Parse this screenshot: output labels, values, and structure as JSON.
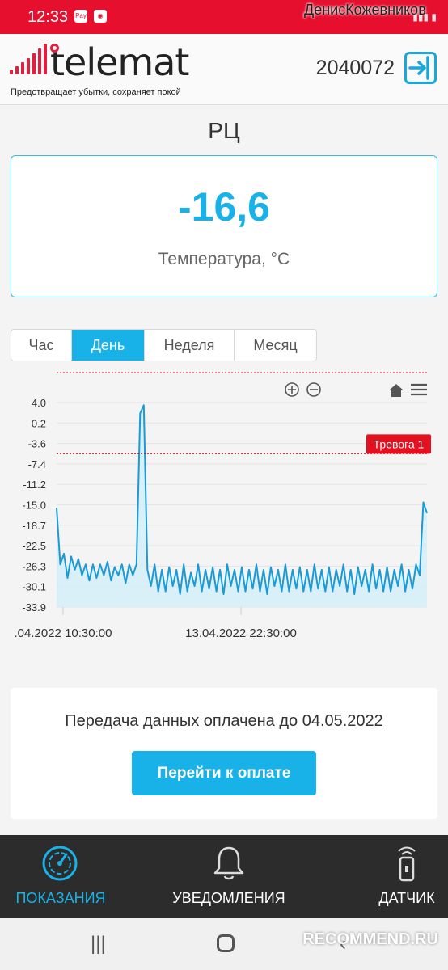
{
  "status_bar": {
    "time": "12:33",
    "username": "ДенисКожевников"
  },
  "header": {
    "brand": "telemat",
    "tagline": "Предотвращает убытки, сохраняет покой",
    "device_id": "2040072"
  },
  "title": "РЦ",
  "temperature": {
    "value": "-16,6",
    "label": "Температура, °C"
  },
  "tabs": [
    {
      "label": "Час",
      "active": false
    },
    {
      "label": "День",
      "active": true
    },
    {
      "label": "Неделя",
      "active": false
    },
    {
      "label": "Месяц",
      "active": false
    }
  ],
  "chart_data": {
    "type": "area",
    "ytick_labels": [
      "4.0",
      "0.2",
      "-3.6",
      "-7.4",
      "-11.2",
      "-15.0",
      "-18.7",
      "-22.5",
      "-26.3",
      "-30.1",
      "-33.9"
    ],
    "ylim": [
      -33.9,
      4.0
    ],
    "xtick_labels": [
      ".04.2022 10:30:00",
      "13.04.2022 22:30:00"
    ],
    "alarm_label": "Тревога 1",
    "alarm_threshold": -5.5,
    "grid": true,
    "series": [
      {
        "values": [
          -15.5,
          -26.0,
          -24.0,
          -28.5,
          -24.5,
          -27.0,
          -25.0,
          -28.0,
          -26.0,
          -29.0,
          -26.0,
          -28.5,
          -26.0,
          -28.0,
          -25.5,
          -29.0,
          -26.5,
          -28.0,
          -26.0,
          -29.5,
          -26.0,
          -28.0,
          -26.0,
          2.0,
          3.5,
          -27.0,
          -30.0,
          -26.0,
          -31.0,
          -27.0,
          -31.0,
          -26.5,
          -30.0,
          -27.0,
          -31.5,
          -26.0,
          -31.0,
          -27.5,
          -30.0,
          -26.0,
          -31.0,
          -27.0,
          -30.5,
          -26.5,
          -31.0,
          -27.0,
          -31.5,
          -26.0,
          -30.0,
          -27.0,
          -31.0,
          -26.5,
          -31.0,
          -27.0,
          -30.5,
          -26.0,
          -31.0,
          -27.0,
          -31.5,
          -26.5,
          -30.0,
          -27.0,
          -31.0,
          -26.0,
          -31.0,
          -27.0,
          -30.5,
          -26.5,
          -31.0,
          -27.0,
          -31.0,
          -26.0,
          -30.5,
          -27.0,
          -31.0,
          -26.5,
          -31.0,
          -27.0,
          -30.0,
          -26.0,
          -31.0,
          -27.0,
          -31.5,
          -26.5,
          -30.0,
          -27.0,
          -31.0,
          -26.0,
          -30.5,
          -27.0,
          -31.0,
          -26.5,
          -31.0,
          -27.0,
          -30.0,
          -26.0,
          -31.0,
          -27.0,
          -30.5,
          -26.0,
          -28.0,
          -14.5,
          -16.5
        ]
      }
    ]
  },
  "payment": {
    "text": "Передача данных оплачена до 04.05.2022",
    "button": "Перейти к оплате"
  },
  "nav": [
    {
      "label": "ПОКАЗАНИЯ",
      "active": true
    },
    {
      "label": "УВЕДОМЛЕНИЯ",
      "active": false
    },
    {
      "label": "ДАТЧИК",
      "active": false
    }
  ],
  "watermark": "RECOMMEND.RU",
  "colors": {
    "accent": "#19b2e8",
    "brand_red": "#e11f3e",
    "alarm": "#e3101f"
  }
}
